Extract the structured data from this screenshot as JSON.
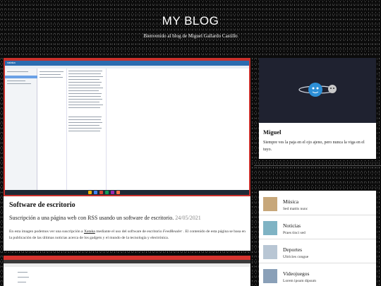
{
  "header": {
    "title": "MY BLOG",
    "description": "Bienvenido al blog de    Miguel Gallardo Castillo"
  },
  "posts": [
    {
      "title": "Software de escritorio",
      "subtitle": "Suscripción a una página web con RSS usando un software de escritorio.",
      "date": "24/05/2021",
      "excerpt_1": "En esta imagen podemos ver una suscripción a ",
      "excerpt_link": "Xataka",
      "excerpt_2": " mediante el uso del software de escritorio ",
      "excerpt_app": "FeedReader",
      "excerpt_3": " . El contenido de esta página se basa en la publicación de las últimas noticias acerca de los gadgets y el mundo de la tecnología y electrónica.",
      "screenshot_brand": "xataka"
    }
  ],
  "profile": {
    "name": "Miguel",
    "quote": "Siempre ves la paja en el ojo ajeno, pero nunca la viga en el tuyo."
  },
  "categories": [
    {
      "title": "Música",
      "subtitle": "Sed mattis nunc",
      "thumb_color": "#c7a77a"
    },
    {
      "title": "Noticias",
      "subtitle": "Praes tinci sed",
      "thumb_color": "#7fb3c4"
    },
    {
      "title": "Deportes",
      "subtitle": "Ultricies congue",
      "thumb_color": "#b8c6d4"
    },
    {
      "title": "Videojuegos",
      "subtitle": "Lorem ipsum dipsum",
      "thumb_color": "#8aa0b8"
    }
  ],
  "colors": {
    "accent_red": "#c9302c",
    "profile_banner": "#1f2230",
    "planet": "#2d8fd6"
  }
}
